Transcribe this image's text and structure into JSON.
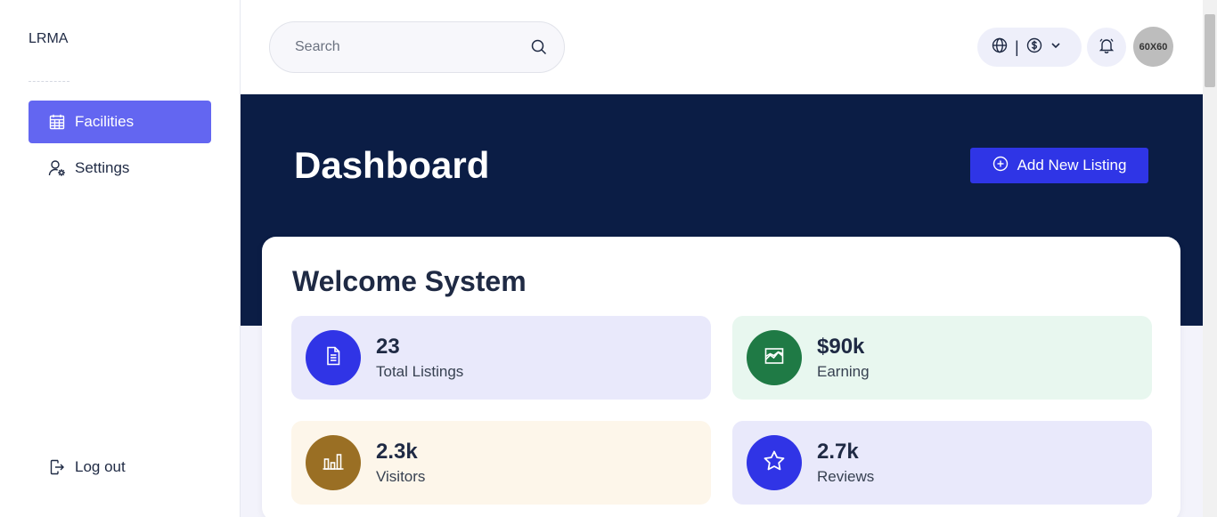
{
  "sidebar": {
    "brand": "LRMA",
    "items": [
      {
        "label": "Facilities",
        "icon": "calendar-icon",
        "active": true
      },
      {
        "label": "Settings",
        "icon": "user-settings-icon",
        "active": false
      }
    ],
    "logout_label": "Log out"
  },
  "topbar": {
    "search_placeholder": "Search",
    "currency_separator": "|",
    "avatar_text": "60X60"
  },
  "hero": {
    "title": "Dashboard",
    "add_button_label": "Add New Listing"
  },
  "card": {
    "welcome": "Welcome System",
    "stats": [
      {
        "value": "23",
        "label": "Total Listings",
        "icon": "document-icon",
        "color": "#3034e6"
      },
      {
        "value": "$90k",
        "label": "Earning",
        "icon": "chart-area-icon",
        "color": "#1f7a45"
      },
      {
        "value": "2.3k",
        "label": "Visitors",
        "icon": "bar-chart-icon",
        "color": "#9a6f24"
      },
      {
        "value": "2.7k",
        "label": "Reviews",
        "icon": "star-icon",
        "color": "#3034e6"
      }
    ]
  },
  "colors": {
    "accent": "#6366f1",
    "hero_bg": "#0b1d45",
    "primary_button": "#2f35e6"
  }
}
